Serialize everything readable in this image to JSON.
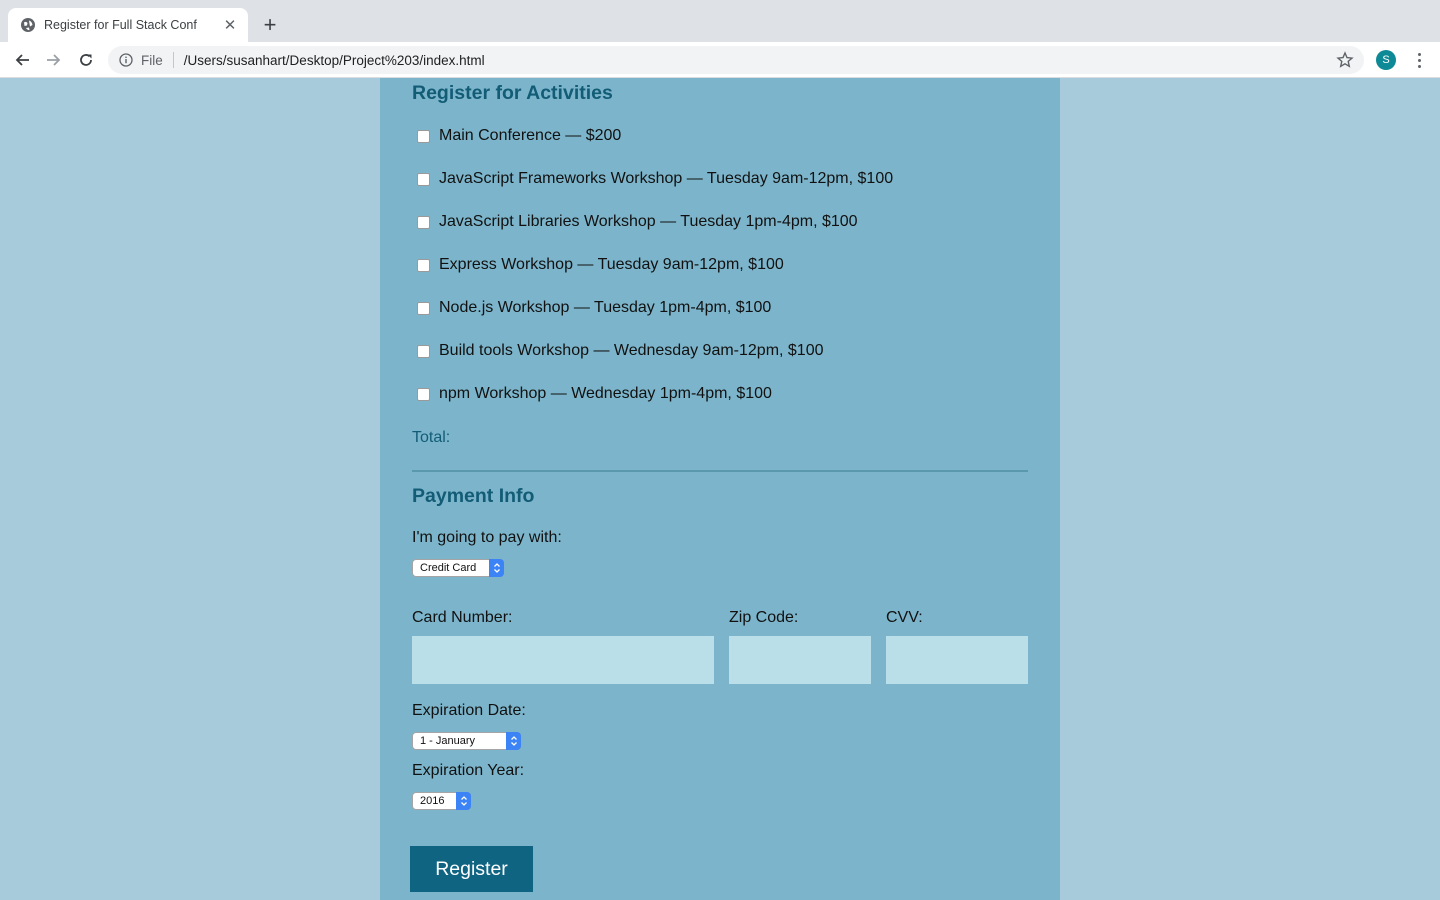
{
  "browser": {
    "tab_title": "Register for Full Stack Conf",
    "scheme_label": "File",
    "url": "/Users/susanhart/Desktop/Project%203/index.html",
    "profile_initial": "S",
    "profile_color": "#0e8a96"
  },
  "activities": {
    "heading": "Register for Activities",
    "items": [
      {
        "label": "Main Conference — $200",
        "checked": false
      },
      {
        "label": "JavaScript Frameworks Workshop — Tuesday 9am-12pm, $100",
        "checked": false
      },
      {
        "label": "JavaScript Libraries Workshop — Tuesday 1pm-4pm, $100",
        "checked": false
      },
      {
        "label": "Express Workshop — Tuesday 9am-12pm, $100",
        "checked": false
      },
      {
        "label": "Node.js Workshop — Tuesday 1pm-4pm, $100",
        "checked": false
      },
      {
        "label": "Build tools Workshop — Wednesday 9am-12pm, $100",
        "checked": false
      },
      {
        "label": "npm Workshop — Wednesday 1pm-4pm, $100",
        "checked": false
      }
    ],
    "total_label": "Total:"
  },
  "payment": {
    "heading": "Payment Info",
    "pay_with_label": "I'm going to pay with:",
    "pay_with_value": "Credit Card",
    "card_number_label": "Card Number:",
    "zip_label": "Zip Code:",
    "cvv_label": "CVV:",
    "card_number_value": "",
    "zip_value": "",
    "cvv_value": "",
    "exp_date_label": "Expiration Date:",
    "exp_date_value": "1 - January",
    "exp_year_label": "Expiration Year:",
    "exp_year_value": "2016"
  },
  "register_label": "Register",
  "colors": {
    "page_bg": "#a8cbdb",
    "panel_bg": "#7cb5cb",
    "heading": "#135c76",
    "input_bg": "#bbdfe9",
    "button_bg": "#0f6482"
  }
}
